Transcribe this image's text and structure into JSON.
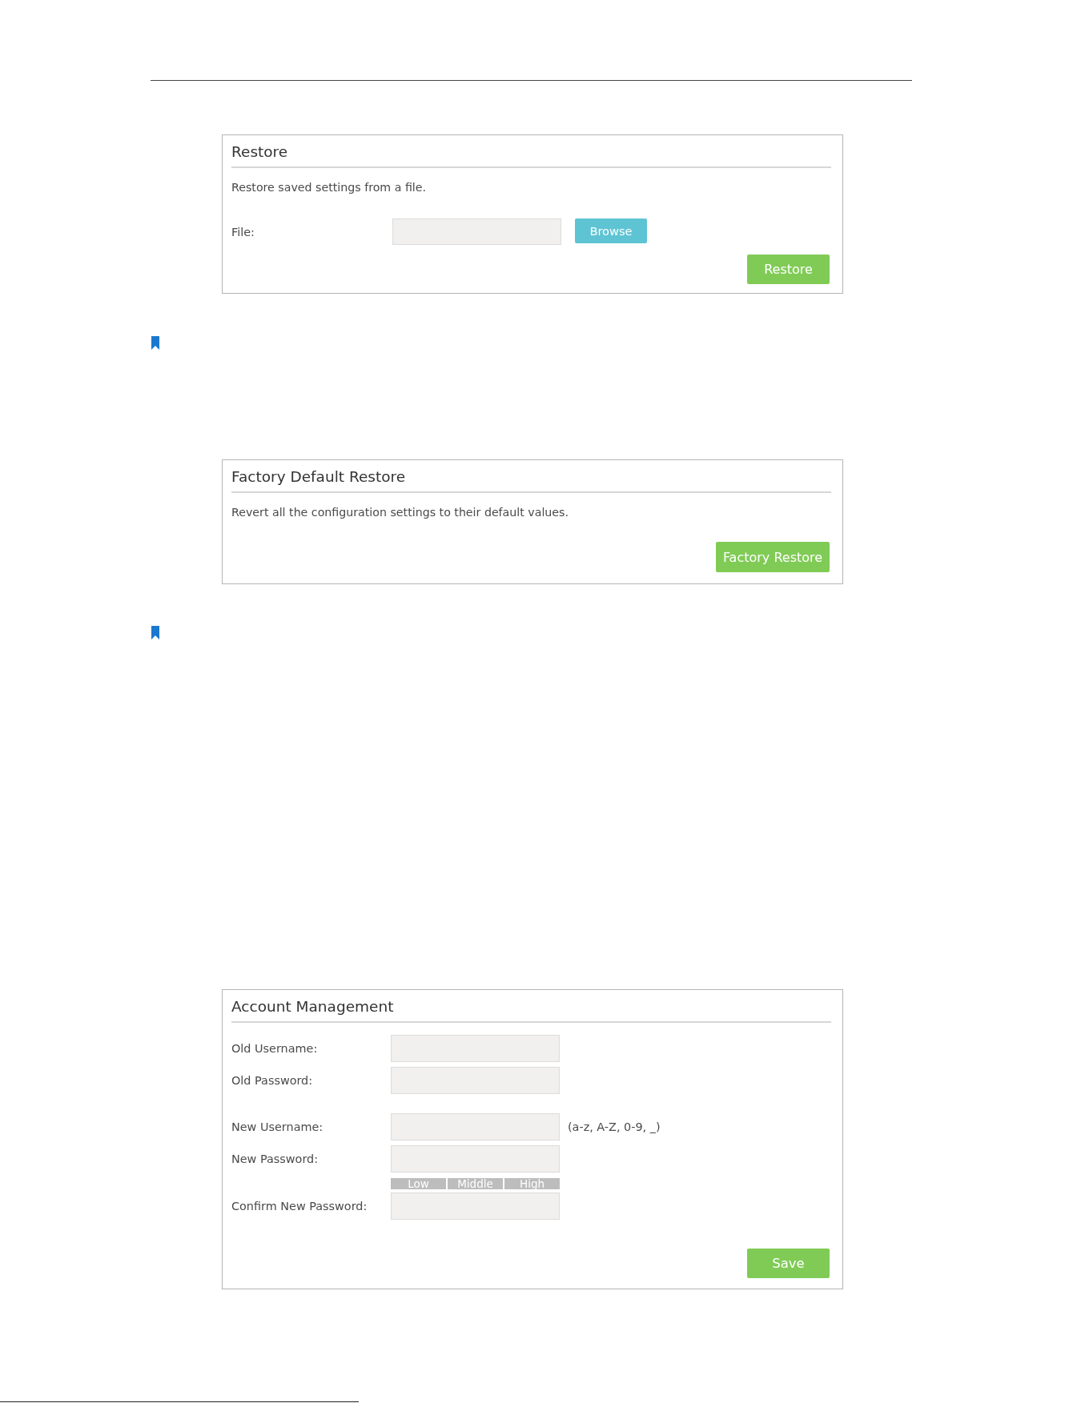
{
  "restore_panel": {
    "title": "Restore",
    "description": "Restore saved settings from a file.",
    "file_field": {
      "label": "File:"
    },
    "browse_button": "Browse",
    "submit_button": "Restore"
  },
  "factory_panel": {
    "title": "Factory Default Restore",
    "description": "Revert all the configuration settings to their default values.",
    "submit_button": "Factory Restore"
  },
  "account_panel": {
    "title": "Account Management",
    "field_groups": [
      {
        "fields": [
          {
            "label": "Old Username:"
          },
          {
            "label": "Old Password:"
          }
        ]
      },
      {
        "fields": [
          {
            "label": "New Username:",
            "hint": "(a-z, A-Z, 0-9, _)"
          },
          {
            "label": "New Password:",
            "strength_labels": [
              "Low",
              "Middle",
              "High"
            ]
          },
          {
            "label": "Confirm New Password:"
          }
        ]
      }
    ],
    "submit_button": "Save"
  }
}
